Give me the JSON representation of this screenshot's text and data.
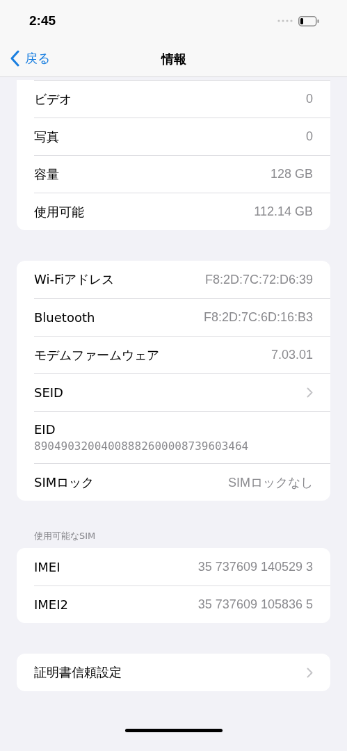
{
  "status_bar": {
    "time": "2:45"
  },
  "nav": {
    "back": "戻る",
    "title": "情報"
  },
  "groups": [
    {
      "cut_top": true,
      "rows": [
        {
          "kind": "value",
          "label": "ビデオ",
          "value": "0"
        },
        {
          "kind": "value",
          "label": "写真",
          "value": "0"
        },
        {
          "kind": "value",
          "label": "容量",
          "value": "128 GB"
        },
        {
          "kind": "value",
          "label": "使用可能",
          "value": "112.14 GB"
        }
      ]
    },
    {
      "cut_top": false,
      "rows": [
        {
          "kind": "value",
          "label": "Wi-Fiアドレス",
          "value": "F8:2D:7C:72:D6:39"
        },
        {
          "kind": "value",
          "label": "Bluetooth",
          "value": "F8:2D:7C:6D:16:B3"
        },
        {
          "kind": "value",
          "label": "モデムファームウェア",
          "value": "7.03.01"
        },
        {
          "kind": "chevron",
          "label": "SEID"
        },
        {
          "kind": "stacked",
          "label": "EID",
          "value": "89049032004008882600008739603464"
        },
        {
          "kind": "value",
          "label": "SIMロック",
          "value": "SIMロックなし"
        }
      ]
    },
    {
      "header": "使用可能なSIM",
      "cut_top": false,
      "rows": [
        {
          "kind": "value",
          "label": "IMEI",
          "value": "35 737609 140529 3"
        },
        {
          "kind": "value",
          "label": "IMEI2",
          "value": "35 737609 105836 5"
        }
      ]
    },
    {
      "cut_top": false,
      "rows": [
        {
          "kind": "chevron",
          "label": "証明書信頼設定"
        }
      ]
    }
  ]
}
